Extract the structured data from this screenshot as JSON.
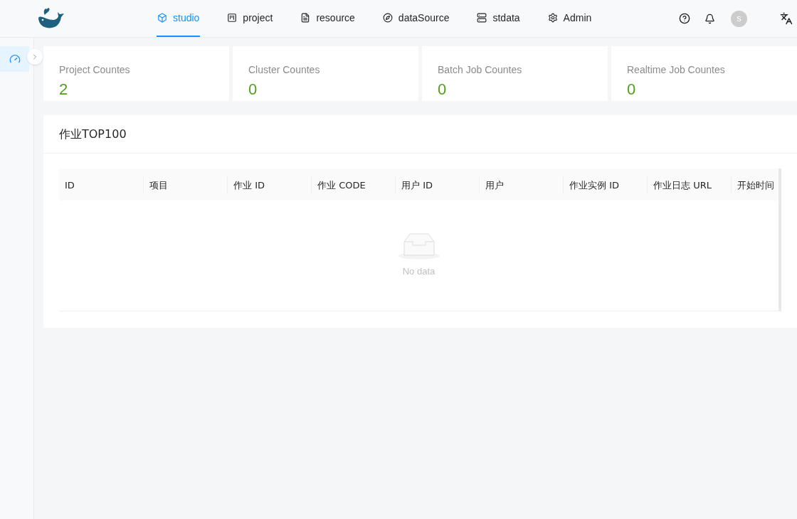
{
  "nav": [
    {
      "label": "studio",
      "selected": true
    },
    {
      "label": "project",
      "selected": false
    },
    {
      "label": "resource",
      "selected": false
    },
    {
      "label": "dataSource",
      "selected": false
    },
    {
      "label": "stdata",
      "selected": false
    },
    {
      "label": "Admin",
      "selected": false
    }
  ],
  "avatar": "s",
  "sidebar": {
    "items": [
      {
        "selected": true
      }
    ]
  },
  "stats": [
    {
      "label": "Project Countes",
      "value": "2"
    },
    {
      "label": "Cluster Countes",
      "value": "0"
    },
    {
      "label": "Batch Job Countes",
      "value": "0"
    },
    {
      "label": "Realtime Job Countes",
      "value": "0"
    }
  ],
  "panel": {
    "title": "作业TOP100",
    "table": {
      "columns": [
        "ID",
        "项目",
        "作业 ID",
        "作业 CODE",
        "用户 ID",
        "用户",
        "作业实例 ID",
        "作业日志 URL",
        "开始时间"
      ],
      "empty_text": "No data"
    }
  }
}
